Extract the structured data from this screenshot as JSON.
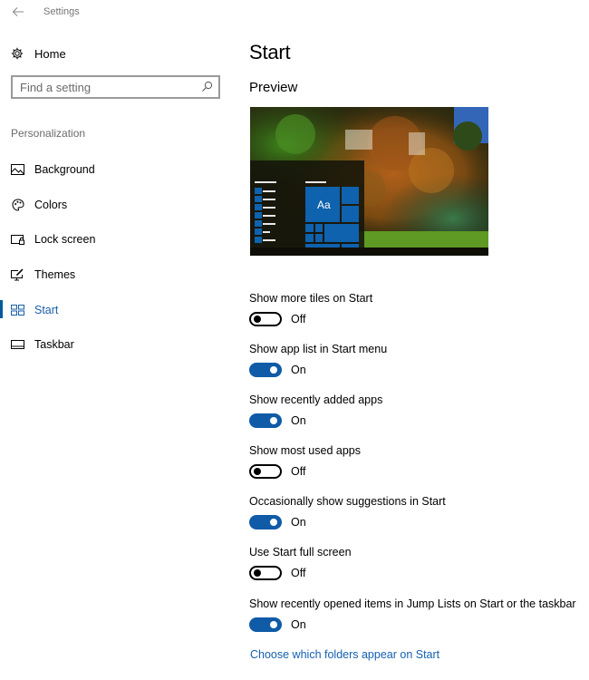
{
  "window": {
    "title": "Settings",
    "back_icon": "arrow-left-icon"
  },
  "sidebar": {
    "home": {
      "label": "Home",
      "icon": "gear-icon"
    },
    "search": {
      "placeholder": "Find a setting",
      "value": "",
      "icon": "search-icon"
    },
    "section_label": "Personalization",
    "items": [
      {
        "label": "Background",
        "icon": "picture-icon",
        "active": false
      },
      {
        "label": "Colors",
        "icon": "palette-icon",
        "active": false
      },
      {
        "label": "Lock screen",
        "icon": "lock-screen-icon",
        "active": false
      },
      {
        "label": "Themes",
        "icon": "themes-icon",
        "active": false
      },
      {
        "label": "Start",
        "icon": "start-tiles-icon",
        "active": true
      },
      {
        "label": "Taskbar",
        "icon": "taskbar-icon",
        "active": false
      }
    ]
  },
  "main": {
    "title": "Start",
    "preview_heading": "Preview",
    "preview": {
      "tile_text": "Aa",
      "accent_color": "#0f62ad"
    },
    "settings": [
      {
        "label": "Show more tiles on Start",
        "on": false,
        "state_label": "Off"
      },
      {
        "label": "Show app list in Start menu",
        "on": true,
        "state_label": "On"
      },
      {
        "label": "Show recently added apps",
        "on": true,
        "state_label": "On"
      },
      {
        "label": "Show most used apps",
        "on": false,
        "state_label": "Off"
      },
      {
        "label": "Occasionally show suggestions in Start",
        "on": true,
        "state_label": "On"
      },
      {
        "label": "Use Start full screen",
        "on": false,
        "state_label": "Off"
      },
      {
        "label": "Show recently opened items in Jump Lists on Start or the taskbar",
        "on": true,
        "state_label": "On"
      }
    ],
    "link": "Choose which folders appear on Start"
  },
  "colors": {
    "accent": "#0f5ba7",
    "link": "#1460b0",
    "muted_text": "#6b6b6b"
  }
}
